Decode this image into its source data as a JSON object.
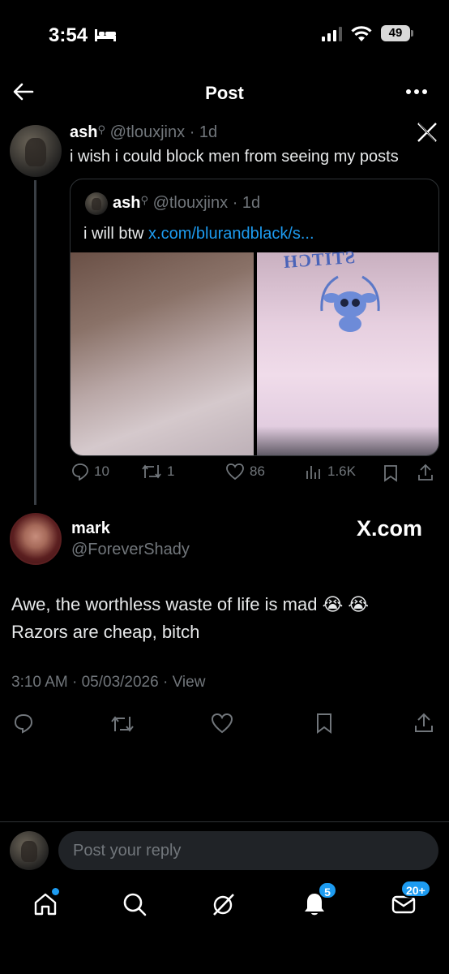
{
  "status_bar": {
    "time": "3:54",
    "battery": "49"
  },
  "nav": {
    "title": "Post"
  },
  "parent_post": {
    "name": "ash",
    "handle": "@tlouxjinx",
    "age": "· 1d",
    "text": "i wish i could block men from seeing my posts",
    "quote": {
      "name": "ash",
      "handle": "@tlouxjinx",
      "age": "· 1d",
      "text": "i will btw",
      "link": "x.com/blurandblack/s...",
      "image_overlay_text": "STITCH"
    },
    "actions": {
      "replies": "10",
      "reposts": "1",
      "likes": "86",
      "views": "1.6K"
    }
  },
  "main_post": {
    "name": "mark",
    "handle": "@ForeverShady",
    "watermark": "X.com",
    "line1": "Awe, the worthless waste of life is mad",
    "line2": "Razors are cheap, bitch",
    "timestamp": "3:10 AM · 05/03/2026 · View"
  },
  "reply": {
    "placeholder": "Post your reply"
  },
  "tabbar": {
    "notifications_badge": "5",
    "messages_badge": "20+"
  },
  "colors": {
    "accent": "#1d9bf0",
    "muted": "#71767b",
    "background": "#000000"
  }
}
